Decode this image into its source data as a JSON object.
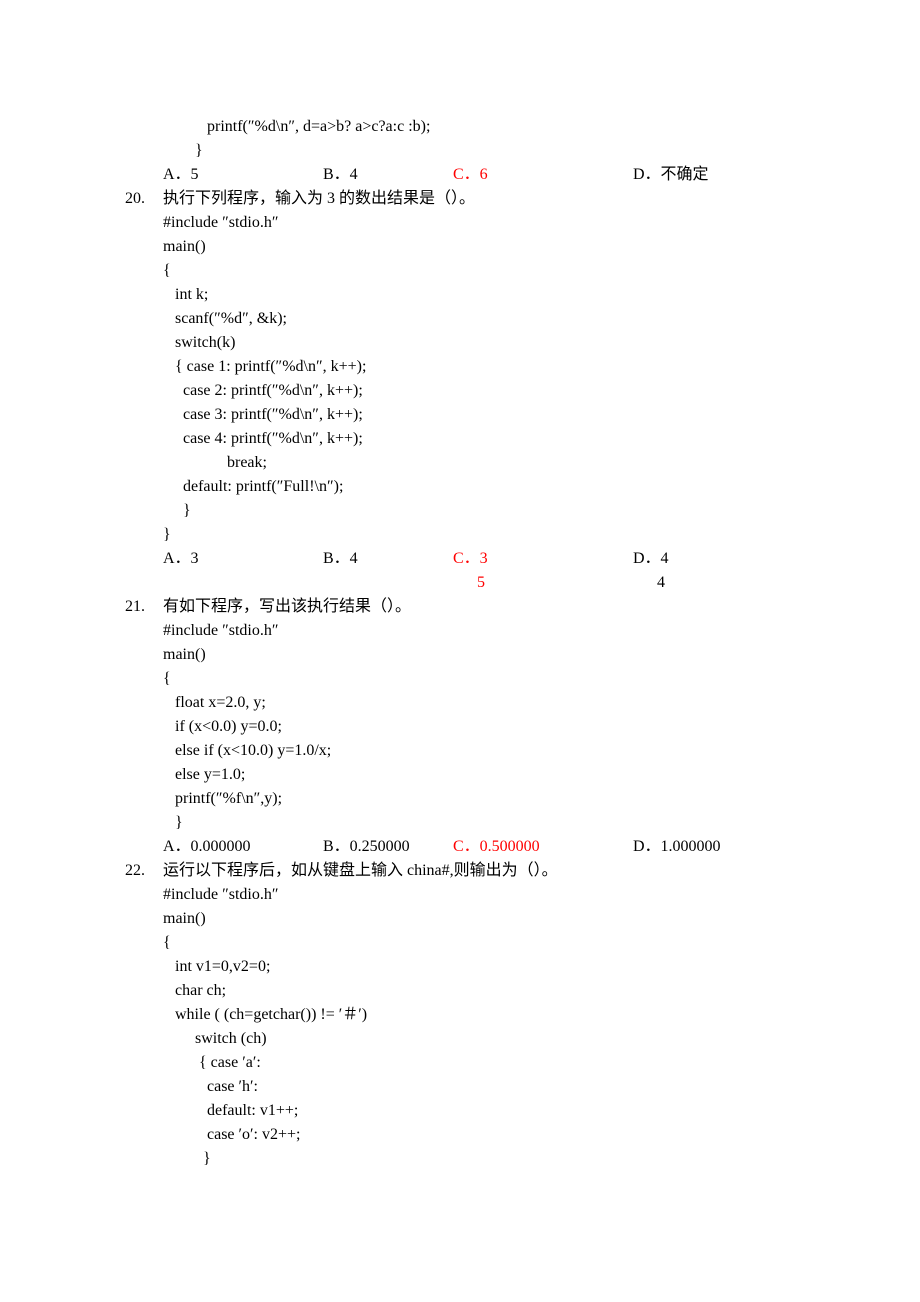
{
  "pre19": {
    "code1": "   printf(″%d\\n″, d=a>b? a>c?a:c :b);",
    "code2": "}",
    "opts": {
      "A": "A．5",
      "B": "B．4",
      "C": "C．6",
      "D": "D．不确定"
    }
  },
  "q20": {
    "num": "20.",
    "text": "执行下列程序，输入为 3 的数出结果是（）。",
    "code": [
      "#include ″stdio.h″",
      "main()",
      "{",
      "   int k;",
      "   scanf(″%d″, &k);",
      "   switch(k)",
      "   { case 1: printf(″%d\\n″, k++);",
      "     case 2: printf(″%d\\n″, k++);",
      "     case 3: printf(″%d\\n″, k++);",
      "     case 4: printf(″%d\\n″, k++);",
      "                break;",
      "     default: printf(″Full!\\n″);",
      "     }",
      "}"
    ],
    "opts": {
      "A": "A．3",
      "B": "B．4",
      "C": "C．3",
      "D": "D．4"
    },
    "opts2": {
      "C": "      5",
      "D": "      4"
    }
  },
  "q21": {
    "num": "21.",
    "text": "有如下程序，写出该执行结果（）。",
    "code": [
      "#include ″stdio.h″",
      "main()",
      "{",
      "   float x=2.0, y;",
      "   if (x<0.0) y=0.0;",
      "   else if (x<10.0) y=1.0/x;",
      "   else y=1.0;",
      "   printf(″%f\\n″,y);",
      "   }"
    ],
    "opts": {
      "A": "A．0.000000",
      "B": "B．0.250000",
      "C": "C．0.500000",
      "D": "D．1.000000"
    }
  },
  "q22": {
    "num": "22.",
    "text": "运行以下程序后，如从键盘上输入 china#,则输出为（）。",
    "code": [
      "#include ″stdio.h″",
      "main()",
      "{",
      "   int v1=0,v2=0;",
      "   char ch;",
      "   while ( (ch=getchar()) != ′＃′)",
      "        switch (ch)",
      "         { case ′a′:",
      "           case ′h′:",
      "           default: v1++;",
      "           case ′o′: v2++;",
      "          }"
    ]
  }
}
